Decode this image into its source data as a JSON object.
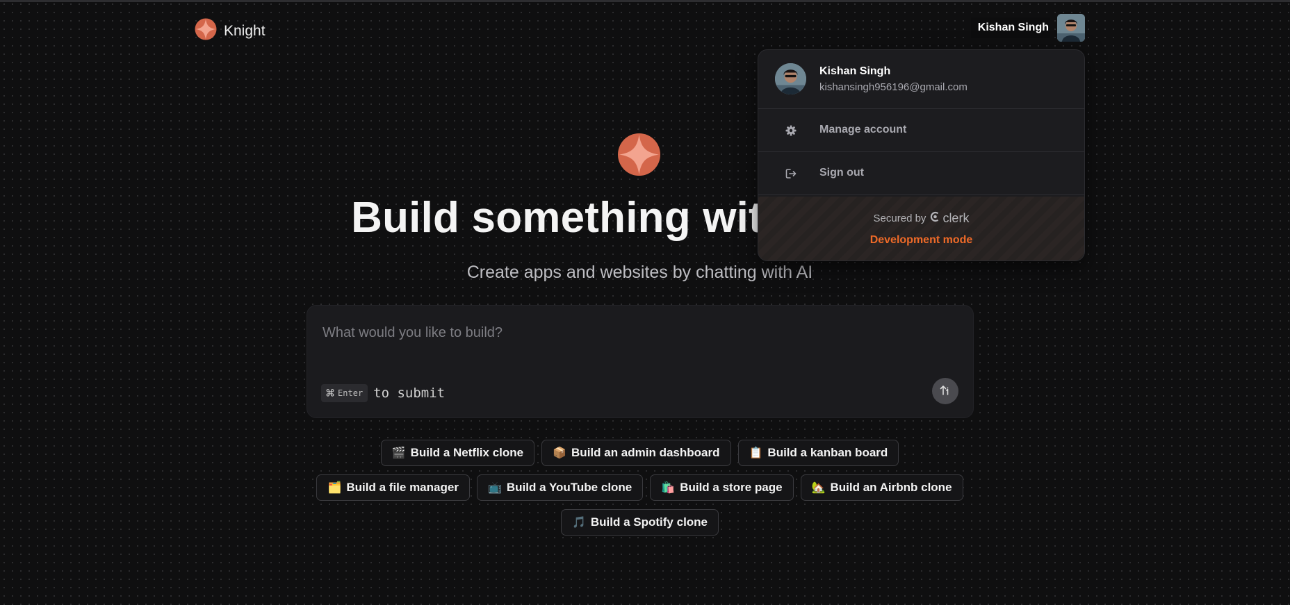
{
  "app": {
    "name": "Knight"
  },
  "header": {
    "user_name": "Kishan Singh"
  },
  "hero": {
    "title": "Build something with Knight",
    "subtitle": "Create apps and websites by chatting with AI"
  },
  "prompt": {
    "placeholder": "What would you like to build?",
    "value": "",
    "kbd_key": "Enter",
    "submit_hint": "to submit"
  },
  "suggestions": [
    [
      {
        "emoji": "🎬",
        "label": "Build a Netflix clone"
      },
      {
        "emoji": "📦",
        "label": "Build an admin dashboard"
      },
      {
        "emoji": "📋",
        "label": "Build a kanban board"
      }
    ],
    [
      {
        "emoji": "🗂️",
        "label": "Build a file manager"
      },
      {
        "emoji": "📺",
        "label": "Build a YouTube clone"
      },
      {
        "emoji": "🛍️",
        "label": "Build a store page"
      },
      {
        "emoji": "🏡",
        "label": "Build an Airbnb clone"
      }
    ],
    [
      {
        "emoji": "🎵",
        "label": "Build a Spotify clone"
      }
    ]
  ],
  "user_menu": {
    "name": "Kishan Singh",
    "email": "kishansingh956196@gmail.com",
    "manage_account": "Manage account",
    "sign_out": "Sign out",
    "secured_by": "Secured by",
    "provider": "clerk",
    "dev_mode": "Development mode"
  },
  "colors": {
    "background": "#0f0f10",
    "accent": "#d4664a",
    "dev_mode": "#ee6a28"
  },
  "icons": {
    "logo": "knight-star-logo-icon",
    "submit": "send-arrow-icon",
    "manage": "gear-icon",
    "sign_out": "sign-out-icon"
  }
}
